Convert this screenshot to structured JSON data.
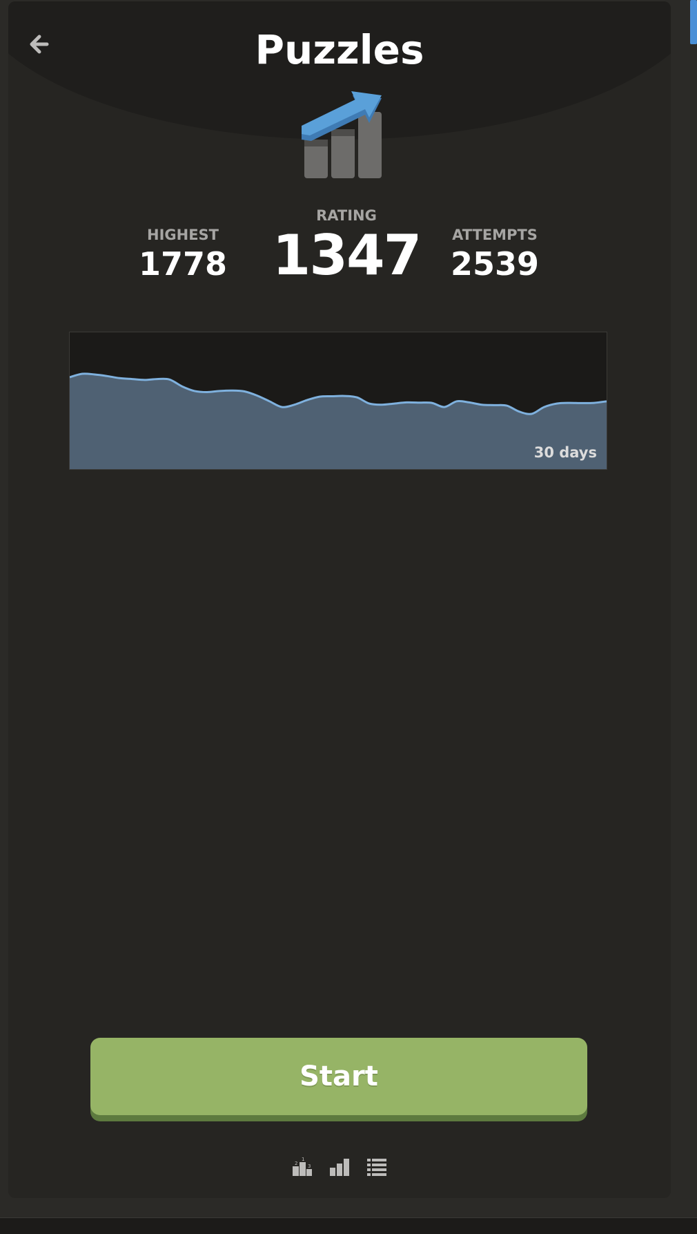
{
  "header": {
    "title": "Puzzles",
    "back_icon": "arrow-left-icon"
  },
  "stats": {
    "highest": {
      "label": "HIGHEST",
      "value": "1778"
    },
    "rating": {
      "label": "RATING",
      "value": "1347"
    },
    "attempts": {
      "label": "ATTEMPTS",
      "value": "2539"
    }
  },
  "chart_data": {
    "type": "area",
    "title": "",
    "xlabel": "",
    "ylabel": "",
    "x_range_label": "30 days",
    "values": [
      1560,
      1575,
      1572,
      1565,
      1556,
      1552,
      1548,
      1552,
      1550,
      1520,
      1500,
      1495,
      1500,
      1502,
      1498,
      1480,
      1455,
      1430,
      1440,
      1460,
      1475,
      1477,
      1478,
      1472,
      1445,
      1440,
      1445,
      1450,
      1449,
      1448,
      1430,
      1455,
      1450,
      1440,
      1438,
      1436,
      1410,
      1400,
      1430,
      1445,
      1448,
      1447,
      1448,
      1455
    ],
    "grid": false,
    "legend": "none",
    "colors": {
      "line": "#7fb1de",
      "fill": "#4f6173",
      "background": "#1b1a18"
    }
  },
  "actions": {
    "start_label": "Start"
  },
  "footer": {
    "icons": [
      "leaderboard-icon",
      "stats-icon",
      "history-list-icon"
    ]
  },
  "colors": {
    "accent": "#96b466",
    "panel": "#262522",
    "hero_arrow": "#5aa0d9"
  }
}
